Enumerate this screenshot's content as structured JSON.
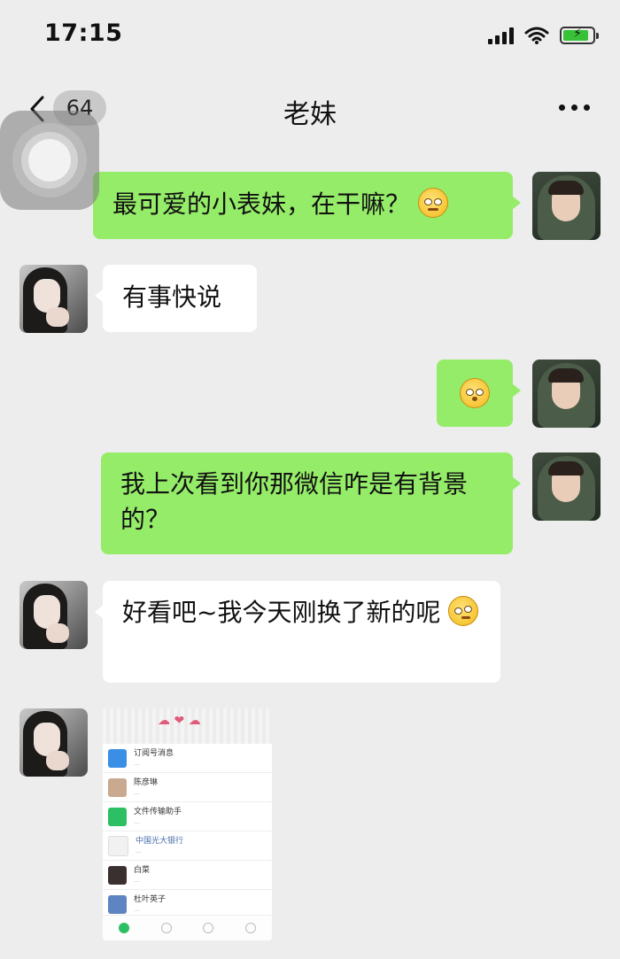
{
  "status_bar": {
    "time": "17:15"
  },
  "nav": {
    "unread_count": "64",
    "title": "老妹"
  },
  "messages": [
    {
      "from": "me",
      "text": "最可爱的小表妹，在干嘛？"
    },
    {
      "from": "sister",
      "text": "有事快说"
    },
    {
      "from": "me",
      "text": ""
    },
    {
      "from": "me",
      "text": "我上次看到你那微信咋是有背景的？"
    },
    {
      "from": "sister",
      "text": "好看吧~我今天刚换了新的呢"
    }
  ],
  "shared_image": {
    "rows": [
      {
        "name": "订阅号消息"
      },
      {
        "name": "陈彦琳"
      },
      {
        "name": "文件传输助手"
      },
      {
        "name": "中国光大银行"
      },
      {
        "name": "白菜"
      },
      {
        "name": "杜叶英子"
      }
    ]
  },
  "colors": {
    "my_bubble": "#95ec69",
    "her_bubble": "#ffffff",
    "background": "#ededed"
  }
}
